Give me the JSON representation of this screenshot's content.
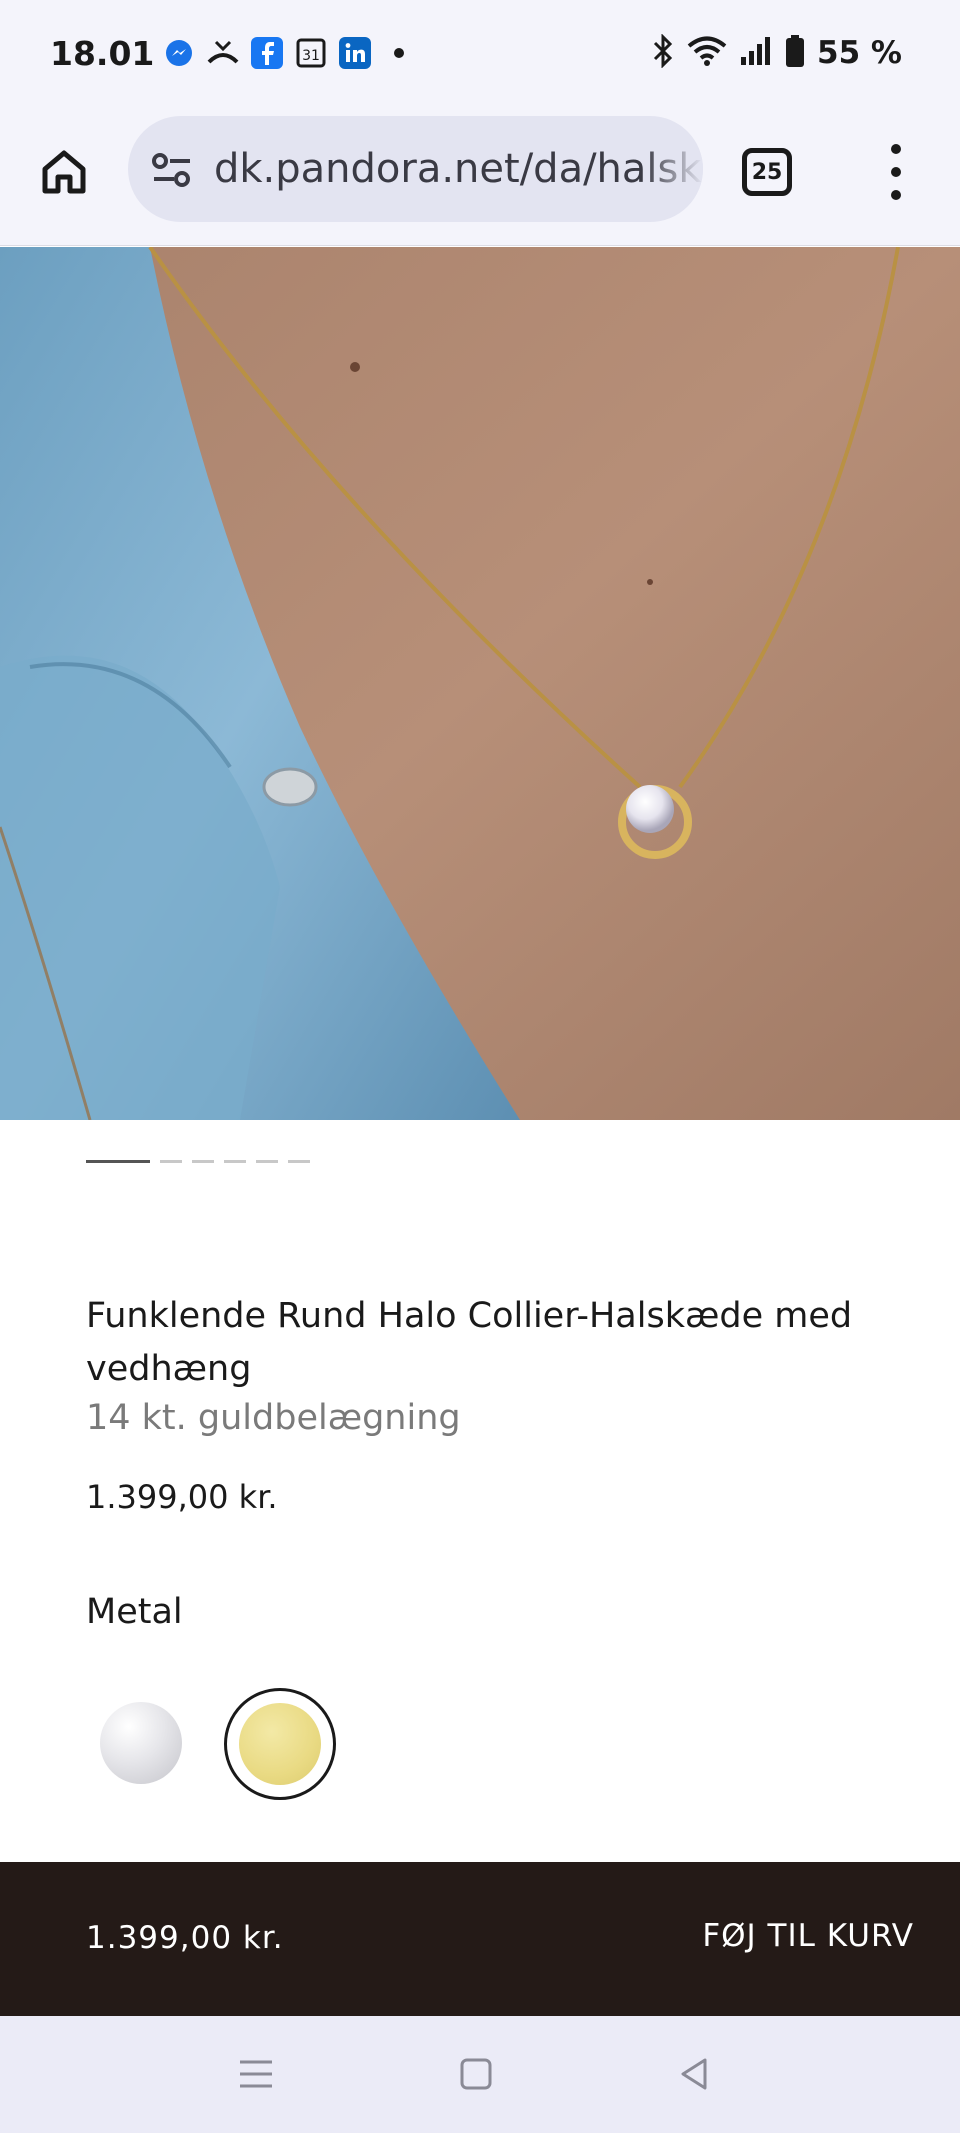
{
  "status_bar": {
    "time": "18.01",
    "notification_icons": [
      "messenger-icon",
      "missed-call-icon",
      "facebook-icon",
      "calendar-icon",
      "linkedin-icon",
      "dot-icon"
    ],
    "calendar_day": "31",
    "battery": "55 %"
  },
  "browser": {
    "url": "dk.pandora.net/da/halsk",
    "tab_count": "25"
  },
  "product": {
    "carousel_count": 6,
    "carousel_active": 0,
    "title": "Funklende Rund Halo Collier-Halskæde med vedhæng",
    "subtitle": "14 kt. guldbelægning",
    "price": "1.399,00 kr.",
    "metal_label": "Metal",
    "metal_options": [
      {
        "name": "silver",
        "color": "#d9d9dd",
        "selected": false
      },
      {
        "name": "gold",
        "color": "#e9da83",
        "selected": true
      }
    ]
  },
  "cart_bar": {
    "price": "1.399,00 kr.",
    "button_label": "FØJ TIL KURV"
  },
  "colors": {
    "cart_bar_bg": "#241a17",
    "browser_bg": "#f4f4fb",
    "url_pill_bg": "#e3e4f1"
  }
}
